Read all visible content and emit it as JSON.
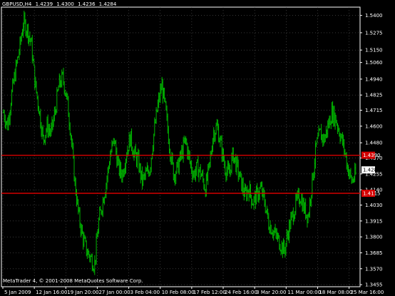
{
  "header": {
    "symbol": "GBPUSD,H4",
    "open": "1.4239",
    "high": "1.4300",
    "low": "1.4236",
    "close": "1.4284"
  },
  "copyright": "MetaTrader 4, © 2001-2008 MetaQuotes Software Corp.",
  "colors": {
    "background": "#000000",
    "bars": "#00b400",
    "level_lines": "#d40000",
    "current_price_tag": "#ffffff"
  },
  "chart_data": {
    "type": "ohlc",
    "title": "GBPUSD,H4",
    "price_range": [
      1.344,
      1.546
    ],
    "y_ticks": [
      "1.5400",
      "1.5275",
      "1.5150",
      "1.5060",
      "1.4940",
      "1.4825",
      "1.4715",
      "1.4600",
      "1.4480",
      "1.4370",
      "1.4255",
      "1.4140",
      "1.4030",
      "1.3915",
      "1.3800",
      "1.3685",
      "1.3570",
      "1.3455"
    ],
    "x_labels": [
      "5 Jan 2009",
      "12 Jan 16:00",
      "19 Jan 20:00",
      "27 Jan 00:00",
      "3 Feb 04:00",
      "10 Feb 08:00",
      "17 Feb 12:00",
      "24 Feb 16:00",
      "3 Mar 20:00",
      "11 Mar 00:00",
      "18 Mar 08:00",
      "25 Mar 16:00"
    ],
    "levels": [
      {
        "price": 1.439,
        "label": "1.4390"
      },
      {
        "price": 1.4115,
        "label": "1.4115"
      }
    ],
    "current_price": {
      "price": 1.4284,
      "label": "1.4284"
    },
    "closes": [
      1.47,
      1.46,
      1.482,
      1.5,
      1.515,
      1.535,
      1.53,
      1.52,
      1.49,
      1.472,
      1.45,
      1.46,
      1.455,
      1.47,
      1.49,
      1.495,
      1.48,
      1.455,
      1.42,
      1.395,
      1.38,
      1.37,
      1.365,
      1.36,
      1.39,
      1.405,
      1.42,
      1.44,
      1.45,
      1.43,
      1.425,
      1.44,
      1.452,
      1.44,
      1.435,
      1.42,
      1.425,
      1.43,
      1.455,
      1.475,
      1.49,
      1.47,
      1.445,
      1.425,
      1.43,
      1.44,
      1.45,
      1.435,
      1.425,
      1.43,
      1.425,
      1.415,
      1.43,
      1.455,
      1.46,
      1.445,
      1.43,
      1.425,
      1.44,
      1.43,
      1.42,
      1.41,
      1.415,
      1.405,
      1.41,
      1.415,
      1.405,
      1.39,
      1.385,
      1.38,
      1.375,
      1.37,
      1.385,
      1.395,
      1.405,
      1.41,
      1.4,
      1.395,
      1.42,
      1.445,
      1.455,
      1.45,
      1.46,
      1.47,
      1.465,
      1.455,
      1.445,
      1.43,
      1.42,
      1.425
    ]
  }
}
